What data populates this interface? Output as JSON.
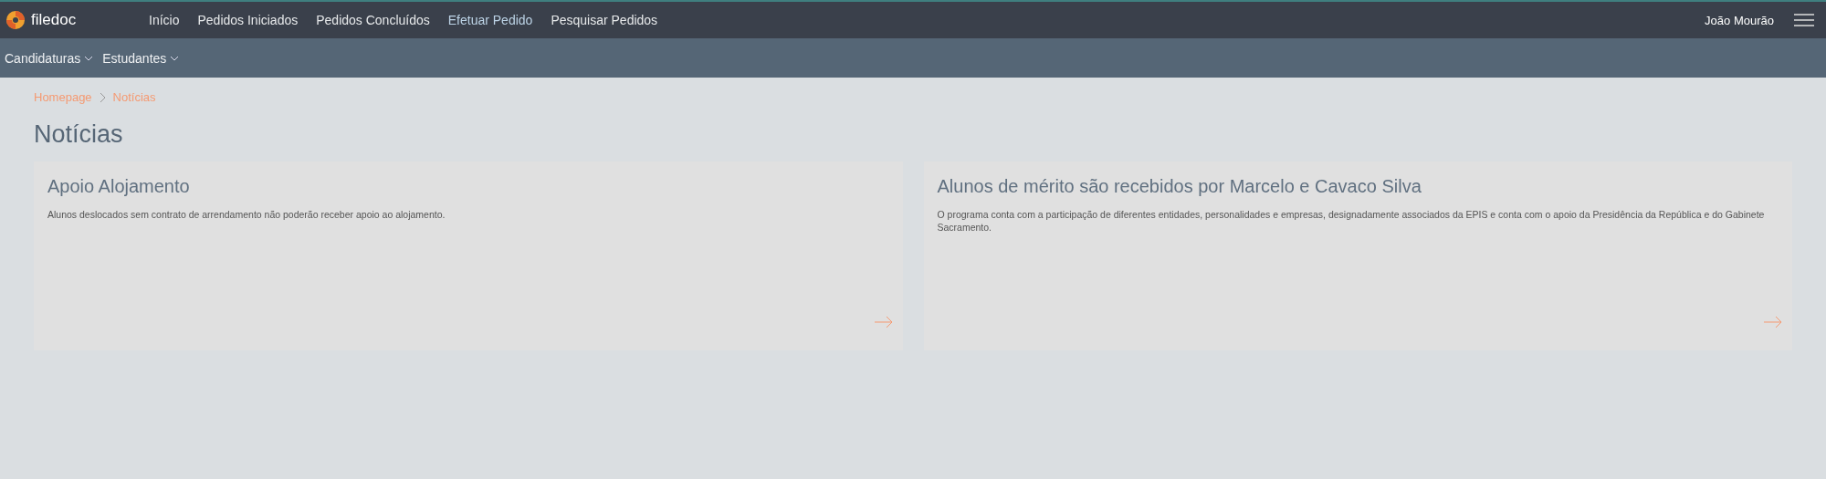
{
  "brand": {
    "name": "filedoc"
  },
  "nav": [
    {
      "label": "Início",
      "selected": false
    },
    {
      "label": "Pedidos Iniciados",
      "selected": false
    },
    {
      "label": "Pedidos Concluídos",
      "selected": false
    },
    {
      "label": "Efetuar Pedido",
      "selected": true
    },
    {
      "label": "Pesquisar Pedidos",
      "selected": false
    }
  ],
  "user": "João Mourão",
  "subnav": [
    {
      "label": "Candidaturas"
    },
    {
      "label": "Estudantes"
    }
  ],
  "breadcrumb": [
    "Homepage",
    "Notícias"
  ],
  "page_title": "Notícias",
  "news": [
    {
      "title": "Apoio Alojamento",
      "text": "Alunos deslocados sem contrato de arrendamento não poderão receber apoio ao alojamento."
    },
    {
      "title": "Alunos de mérito são recebidos por Marcelo e Cavaco Silva",
      "text": "O programa conta com a participação de diferentes entidades, personalidades e empresas, designadamente associados da EPIS e conta com o apoio da Presidência da República e do Gabinete Sacramento."
    }
  ]
}
